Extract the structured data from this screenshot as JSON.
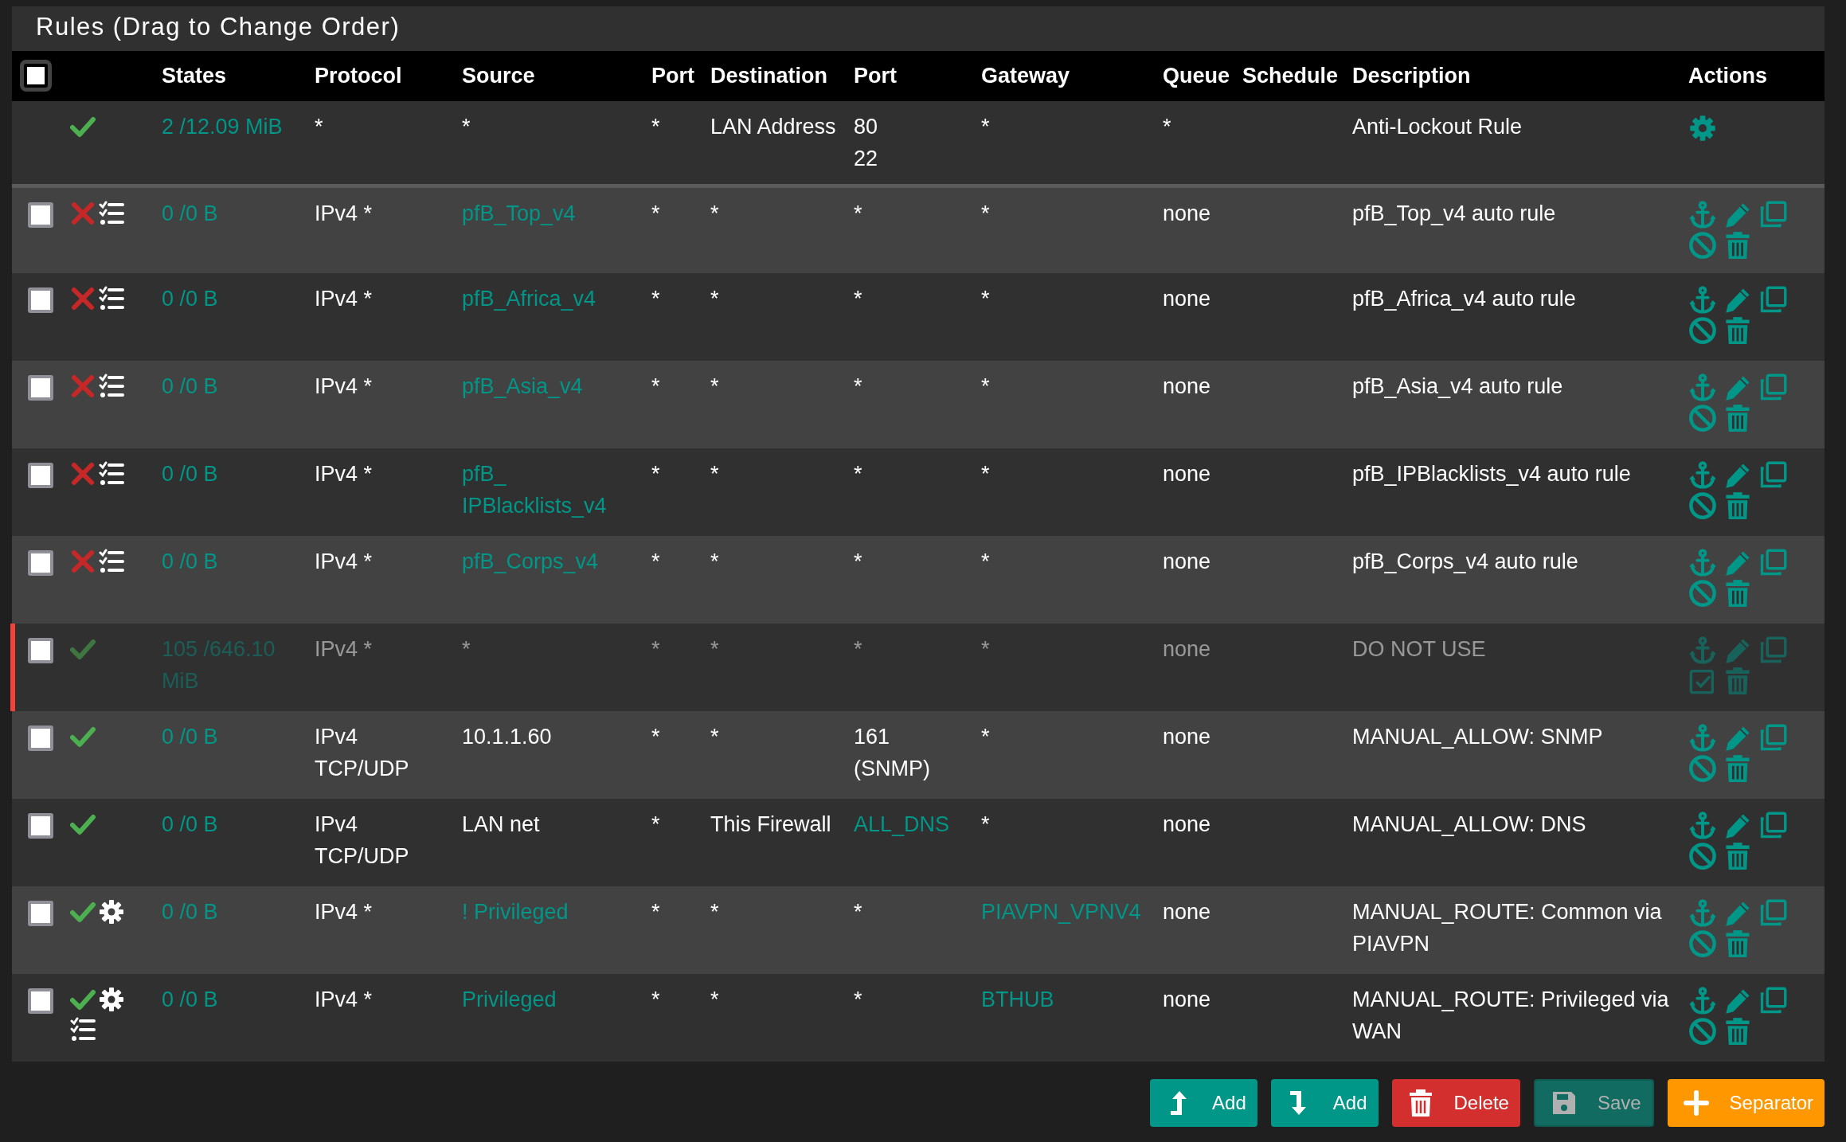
{
  "title": "Rules (Drag to Change Order)",
  "header_checkbox": {
    "checked": false
  },
  "columns": [
    "States",
    "Protocol",
    "Source",
    "Port",
    "Destination",
    "Port",
    "Gateway",
    "Queue",
    "Schedule",
    "Description",
    "Actions"
  ],
  "rows": [
    {
      "separator_after": true,
      "disabled": false,
      "highlighted": false,
      "status": [
        {
          "kind": "pass"
        }
      ],
      "states": "2 /12.09 MiB",
      "protocol": "*",
      "source": "*",
      "source_link": false,
      "port": "*",
      "destination": "LAN Address",
      "dest_port": [
        "80",
        "22"
      ],
      "dest_port_link": false,
      "gateway": "*",
      "gateway_link": false,
      "queue": "*",
      "description": "Anti-Lockout Rule",
      "actions": [
        {
          "kind": "settings"
        }
      ]
    },
    {
      "checked": false,
      "disabled": false,
      "highlighted": false,
      "status": [
        {
          "kind": "block"
        },
        {
          "kind": "log"
        }
      ],
      "states": "0 /0 B",
      "protocol": "IPv4 *",
      "source": "pfB_Top_v4",
      "source_link": true,
      "port": "*",
      "destination": "*",
      "dest_port": [
        "*"
      ],
      "dest_port_link": false,
      "gateway": "*",
      "gateway_link": false,
      "queue": "none",
      "description": "pfB_Top_v4 auto rule",
      "actions": [
        {
          "kind": "anchor"
        },
        {
          "kind": "edit"
        },
        {
          "kind": "copy"
        },
        {
          "kind": "disable"
        },
        {
          "kind": "delete"
        }
      ]
    },
    {
      "checked": false,
      "disabled": false,
      "highlighted": false,
      "status": [
        {
          "kind": "block"
        },
        {
          "kind": "log"
        }
      ],
      "states": "0 /0 B",
      "protocol": "IPv4 *",
      "source": "pfB_Africa_v4",
      "source_link": true,
      "port": "*",
      "destination": "*",
      "dest_port": [
        "*"
      ],
      "dest_port_link": false,
      "gateway": "*",
      "gateway_link": false,
      "queue": "none",
      "description": "pfB_Africa_v4 auto rule",
      "actions": [
        {
          "kind": "anchor"
        },
        {
          "kind": "edit"
        },
        {
          "kind": "copy"
        },
        {
          "kind": "disable"
        },
        {
          "kind": "delete"
        }
      ]
    },
    {
      "checked": false,
      "disabled": false,
      "highlighted": false,
      "status": [
        {
          "kind": "block"
        },
        {
          "kind": "log"
        }
      ],
      "states": "0 /0 B",
      "protocol": "IPv4 *",
      "source": "pfB_Asia_v4",
      "source_link": true,
      "port": "*",
      "destination": "*",
      "dest_port": [
        "*"
      ],
      "dest_port_link": false,
      "gateway": "*",
      "gateway_link": false,
      "queue": "none",
      "description": "pfB_Asia_v4 auto rule",
      "actions": [
        {
          "kind": "anchor"
        },
        {
          "kind": "edit"
        },
        {
          "kind": "copy"
        },
        {
          "kind": "disable"
        },
        {
          "kind": "delete"
        }
      ]
    },
    {
      "checked": false,
      "disabled": false,
      "highlighted": false,
      "status": [
        {
          "kind": "block"
        },
        {
          "kind": "log"
        }
      ],
      "states": "0 /0 B",
      "protocol": "IPv4 *",
      "source": "pfB_ IPBlacklists_v4",
      "source_link": true,
      "port": "*",
      "destination": "*",
      "dest_port": [
        "*"
      ],
      "dest_port_link": false,
      "gateway": "*",
      "gateway_link": false,
      "queue": "none",
      "description": "pfB_IPBlacklists_v4 auto rule",
      "actions": [
        {
          "kind": "anchor"
        },
        {
          "kind": "edit"
        },
        {
          "kind": "copy"
        },
        {
          "kind": "disable"
        },
        {
          "kind": "delete"
        }
      ]
    },
    {
      "checked": false,
      "disabled": false,
      "highlighted": false,
      "status": [
        {
          "kind": "block"
        },
        {
          "kind": "log"
        }
      ],
      "states": "0 /0 B",
      "protocol": "IPv4 *",
      "source": "pfB_Corps_v4",
      "source_link": true,
      "port": "*",
      "destination": "*",
      "dest_port": [
        "*"
      ],
      "dest_port_link": false,
      "gateway": "*",
      "gateway_link": false,
      "queue": "none",
      "description": "pfB_Corps_v4 auto rule",
      "actions": [
        {
          "kind": "anchor"
        },
        {
          "kind": "edit"
        },
        {
          "kind": "copy"
        },
        {
          "kind": "disable"
        },
        {
          "kind": "delete"
        }
      ]
    },
    {
      "checked": false,
      "disabled": true,
      "highlighted": true,
      "status": [
        {
          "kind": "pass"
        }
      ],
      "states": "105 /646.10 MiB",
      "protocol": "IPv4 *",
      "source": "*",
      "source_link": false,
      "port": "*",
      "destination": "*",
      "dest_port": [
        "*"
      ],
      "dest_port_link": false,
      "gateway": "*",
      "gateway_link": false,
      "queue": "none",
      "description": "DO NOT USE",
      "actions": [
        {
          "kind": "anchor"
        },
        {
          "kind": "edit"
        },
        {
          "kind": "copy"
        },
        {
          "kind": "enable"
        },
        {
          "kind": "delete"
        }
      ]
    },
    {
      "checked": false,
      "disabled": false,
      "highlighted": false,
      "status": [
        {
          "kind": "pass"
        }
      ],
      "states": "0 /0 B",
      "protocol": "IPv4 TCP/UDP",
      "source": "10.1.1.60",
      "source_link": false,
      "port": "*",
      "destination": "*",
      "dest_port": [
        "161 (SNMP)"
      ],
      "dest_port_link": false,
      "gateway": "*",
      "gateway_link": false,
      "queue": "none",
      "description": "MANUAL_ALLOW: SNMP",
      "actions": [
        {
          "kind": "anchor"
        },
        {
          "kind": "edit"
        },
        {
          "kind": "copy"
        },
        {
          "kind": "disable"
        },
        {
          "kind": "delete"
        }
      ]
    },
    {
      "checked": false,
      "disabled": false,
      "highlighted": false,
      "status": [
        {
          "kind": "pass"
        }
      ],
      "states": "0 /0 B",
      "protocol": "IPv4 TCP/UDP",
      "source": "LAN net",
      "source_link": false,
      "port": "*",
      "destination": "This Firewall",
      "dest_port": [
        "ALL_DNS"
      ],
      "dest_port_link": true,
      "gateway": "*",
      "gateway_link": false,
      "queue": "none",
      "description": "MANUAL_ALLOW: DNS",
      "actions": [
        {
          "kind": "anchor"
        },
        {
          "kind": "edit"
        },
        {
          "kind": "copy"
        },
        {
          "kind": "disable"
        },
        {
          "kind": "delete"
        }
      ]
    },
    {
      "checked": false,
      "disabled": false,
      "highlighted": false,
      "status": [
        {
          "kind": "pass"
        },
        {
          "kind": "advanced"
        }
      ],
      "states": "0 /0 B",
      "protocol": "IPv4 *",
      "source": "! Privileged",
      "source_link": true,
      "port": "*",
      "destination": "*",
      "dest_port": [
        "*"
      ],
      "dest_port_link": false,
      "gateway": "PIAVPN_VPNV4",
      "gateway_link": true,
      "queue": "none",
      "description": "MANUAL_ROUTE: Common via PIAVPN",
      "actions": [
        {
          "kind": "anchor"
        },
        {
          "kind": "edit"
        },
        {
          "kind": "copy"
        },
        {
          "kind": "disable"
        },
        {
          "kind": "delete"
        }
      ]
    },
    {
      "checked": false,
      "disabled": false,
      "highlighted": false,
      "status": [
        {
          "kind": "pass"
        },
        {
          "kind": "advanced"
        },
        {
          "kind": "log"
        }
      ],
      "states": "0 /0 B",
      "protocol": "IPv4 *",
      "source": "Privileged",
      "source_link": true,
      "port": "*",
      "destination": "*",
      "dest_port": [
        "*"
      ],
      "dest_port_link": false,
      "gateway": "BTHUB",
      "gateway_link": true,
      "queue": "none",
      "description": "MANUAL_ROUTE: Privileged via WAN",
      "actions": [
        {
          "kind": "anchor"
        },
        {
          "kind": "edit"
        },
        {
          "kind": "copy"
        },
        {
          "kind": "disable"
        },
        {
          "kind": "delete"
        }
      ]
    }
  ],
  "buttons": [
    {
      "kind": "add_top",
      "label": "Add",
      "disabled": false
    },
    {
      "kind": "add_bottom",
      "label": "Add",
      "disabled": false
    },
    {
      "kind": "delete",
      "label": "Delete",
      "disabled": false
    },
    {
      "kind": "save",
      "label": "Save",
      "disabled": true
    },
    {
      "kind": "separator",
      "label": "Separator",
      "disabled": false
    }
  ]
}
